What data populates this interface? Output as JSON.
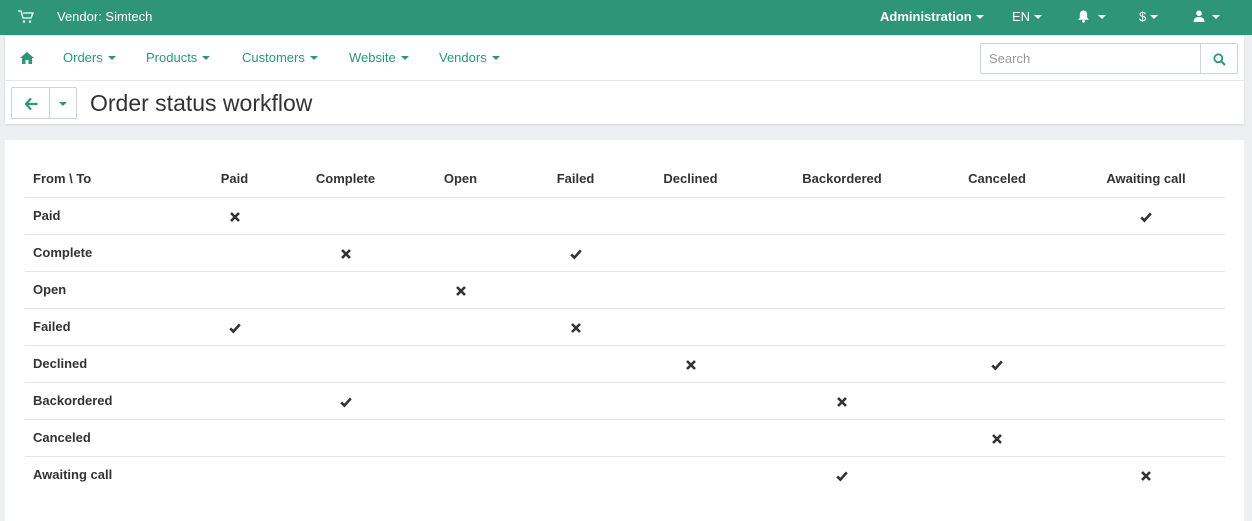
{
  "topbar": {
    "vendor": "Vendor: Simtech",
    "administration": "Administration",
    "language": "EN",
    "currency": "$",
    "icons": [
      "cart-icon",
      "bell-icon",
      "user-icon"
    ]
  },
  "nav": {
    "items": [
      "Orders",
      "Products",
      "Customers",
      "Website",
      "Vendors"
    ],
    "search_placeholder": "Search"
  },
  "page": {
    "title": "Order status workflow"
  },
  "colors": {
    "accent": "#2e9578",
    "background": "#edf0f2"
  },
  "workflow": {
    "corner": "From \\ To",
    "statuses": [
      "Paid",
      "Complete",
      "Open",
      "Failed",
      "Declined",
      "Backordered",
      "Canceled",
      "Awaiting call"
    ],
    "legend_marks": {
      "x": "not allowed",
      "check": "allowed"
    },
    "matrix": [
      [
        "x",
        "",
        "",
        "",
        "",
        "",
        "",
        "check"
      ],
      [
        "",
        "x",
        "",
        "check",
        "",
        "",
        "",
        ""
      ],
      [
        "",
        "",
        "x",
        "",
        "",
        "",
        "",
        ""
      ],
      [
        "check",
        "",
        "",
        "x",
        "",
        "",
        "",
        ""
      ],
      [
        "",
        "",
        "",
        "",
        "x",
        "",
        "check",
        ""
      ],
      [
        "",
        "check",
        "",
        "",
        "",
        "x",
        "",
        ""
      ],
      [
        "",
        "",
        "",
        "",
        "",
        "",
        "x",
        ""
      ],
      [
        "",
        "",
        "",
        "",
        "",
        "check",
        "",
        "x"
      ]
    ]
  }
}
